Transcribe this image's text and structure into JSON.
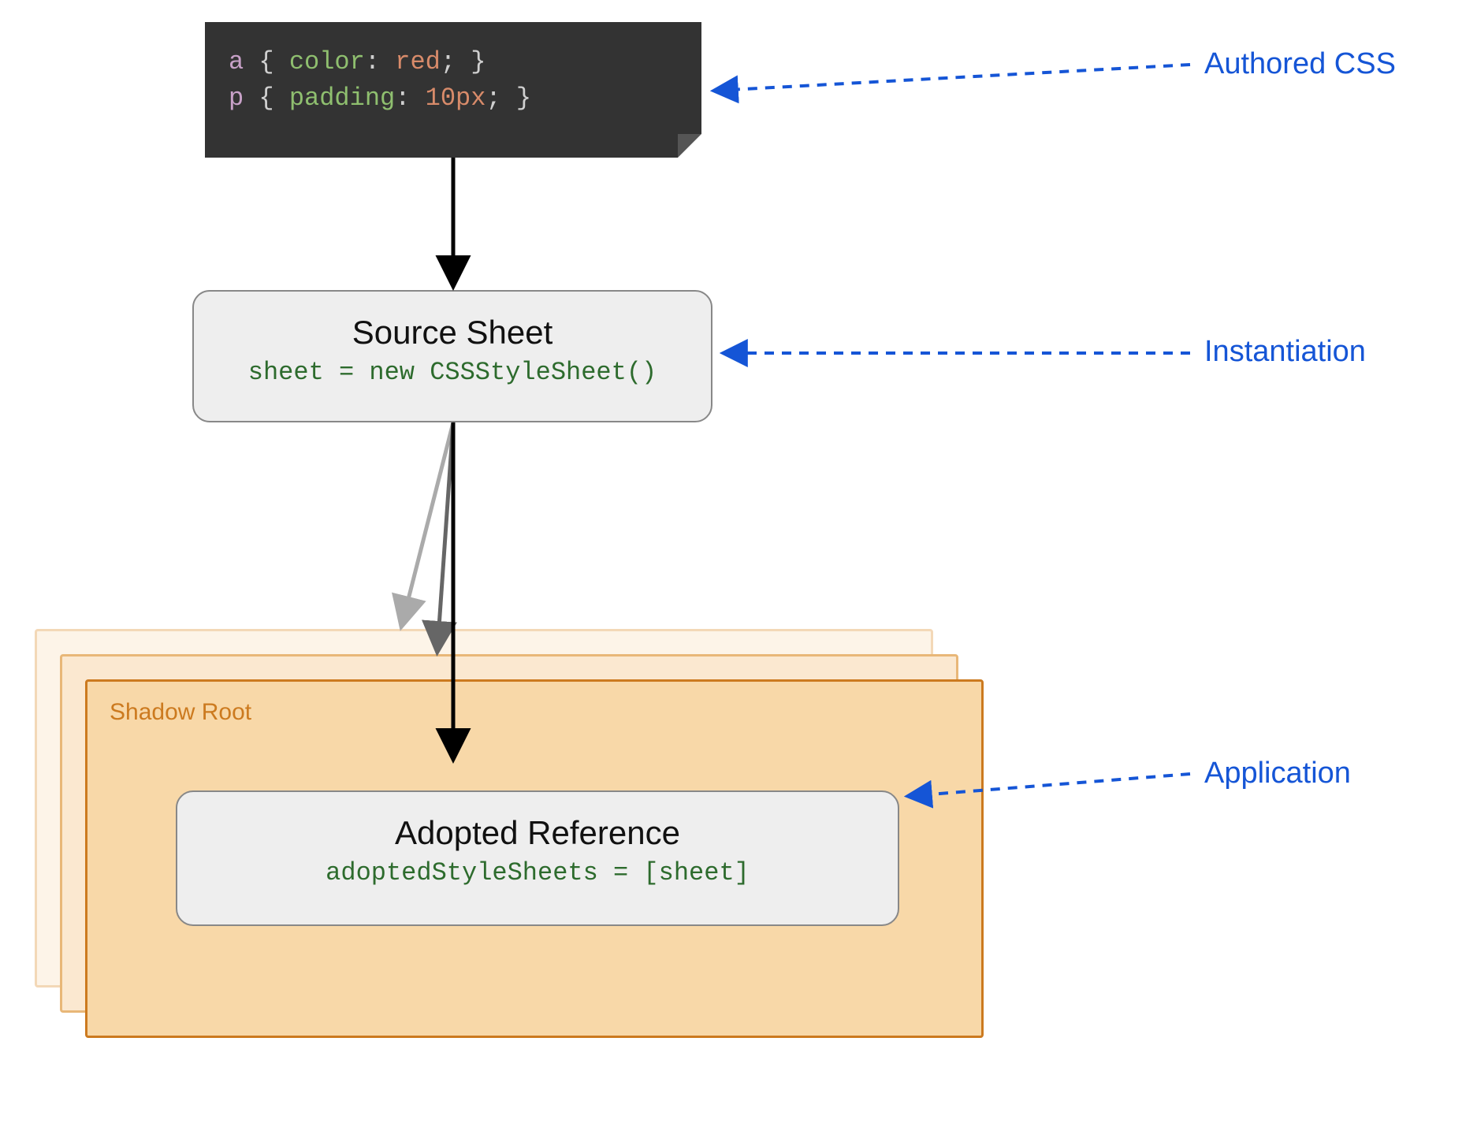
{
  "code": {
    "line1": {
      "selector": "a",
      "open": " { ",
      "prop": "color",
      "colon": ": ",
      "value": "red",
      "semi": "; ",
      "close": "}"
    },
    "line2": {
      "selector": "p",
      "open": " { ",
      "prop": "padding",
      "colon": ": ",
      "value": "10px",
      "semi": "; ",
      "close": "}"
    }
  },
  "source_sheet": {
    "title": "Source Sheet",
    "code": "sheet = new CSSStyleSheet()"
  },
  "shadow_root": {
    "label": "Shadow Root"
  },
  "adopted_reference": {
    "title": "Adopted Reference",
    "code": "adoptedStyleSheets = [sheet]"
  },
  "annotations": {
    "authored_css": "Authored CSS",
    "instantiation": "Instantiation",
    "application": "Application"
  }
}
